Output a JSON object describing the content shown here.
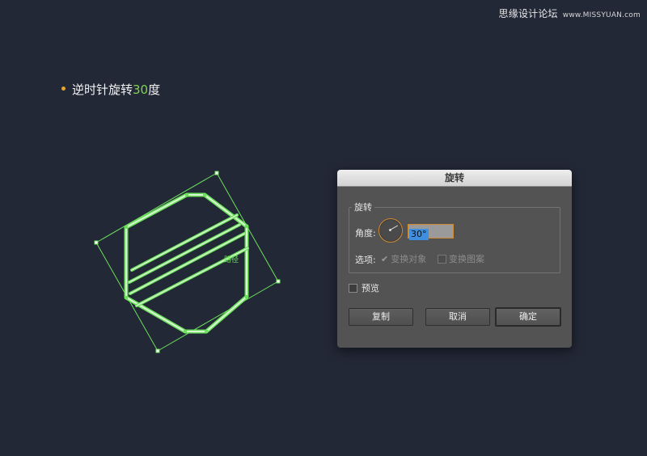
{
  "watermark": {
    "site_name": "思缘设计论坛",
    "domain": "www.MISSYUAN.com"
  },
  "instruction": {
    "prefix": "逆时针旋转",
    "value": "30",
    "suffix": "度",
    "highlight_color": "#7fd34e",
    "bullet_color": "#e7a431"
  },
  "artwork": {
    "stroke_color": "#6be05b",
    "inner_color": "#d8f5d3",
    "center_label": "路径",
    "rotation_degrees": 30
  },
  "dialog": {
    "title": "旋转",
    "group_label": "旋转",
    "angle_label": "角度:",
    "angle_value": "30°",
    "options_label": "选项:",
    "option_transform_objects": "变换对象",
    "option_transform_objects_checked": true,
    "option_transform_patterns": "变换图案",
    "option_transform_patterns_checked": false,
    "preview_label": "预览",
    "preview_checked": false,
    "copy_button": "复制",
    "cancel_button": "取消",
    "ok_button": "确定"
  }
}
